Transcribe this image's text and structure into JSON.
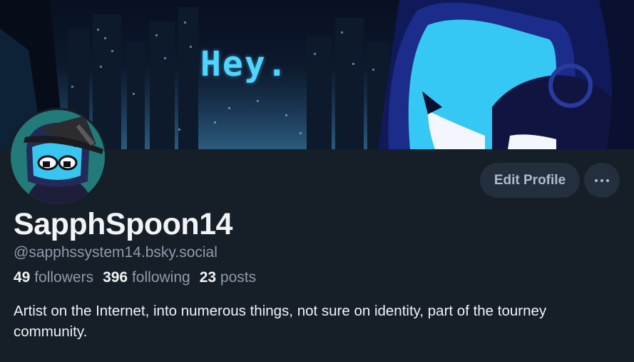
{
  "banner": {
    "text": "Hey."
  },
  "profile": {
    "display_name": "SapphSpoon14",
    "handle": "@sapphssystem14.bsky.social",
    "bio": "Artist on the Internet, into numerous things, not sure on identity, part of the tourney community."
  },
  "stats": {
    "followers_count": "49",
    "followers_label": "followers",
    "following_count": "396",
    "following_label": "following",
    "posts_count": "23",
    "posts_label": "posts"
  },
  "actions": {
    "edit_profile_label": "Edit Profile",
    "more_icon": "ellipsis-icon"
  },
  "colors": {
    "background": "#161e27",
    "button_bg": "#232f3d",
    "muted_text": "#8e9bab",
    "accent_cyan": "#3ccfff"
  }
}
